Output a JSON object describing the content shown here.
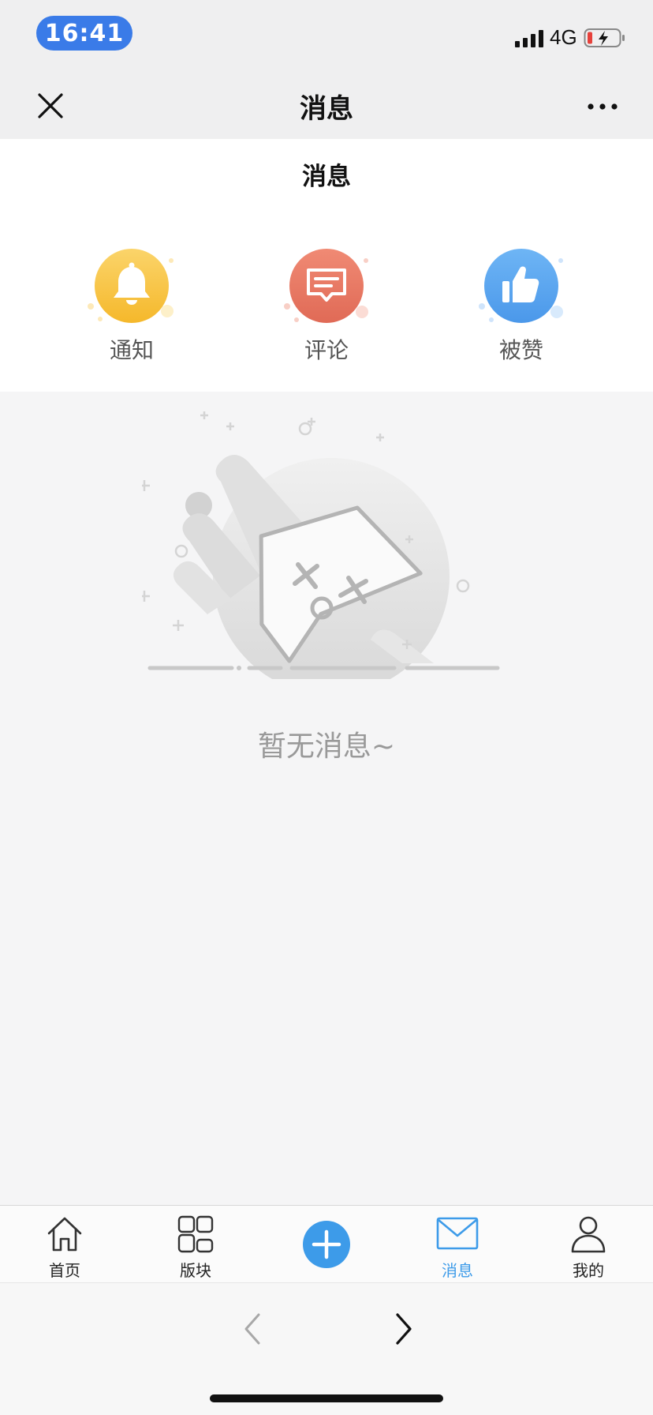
{
  "status_bar": {
    "time": "16:41",
    "network": "4G",
    "icons": [
      "signal-icon",
      "battery-charging-icon"
    ]
  },
  "nav_bar": {
    "title": "消息",
    "icons": [
      "close-icon",
      "more-icon"
    ]
  },
  "message_header": {
    "title": "消息",
    "categories": [
      {
        "label": "通知",
        "icon": "bell-icon",
        "color": "#f7c23e"
      },
      {
        "label": "评论",
        "icon": "comment-icon",
        "color": "#ea7a66"
      },
      {
        "label": "被赞",
        "icon": "thumbs-up-icon",
        "color": "#5aa6ef"
      }
    ]
  },
  "empty_state": {
    "text": "暂无消息~",
    "icon": "empty-star-illustration"
  },
  "tab_bar": {
    "active_color": "#3d9be9",
    "tabs": [
      {
        "label": "首页",
        "icon": "home-icon"
      },
      {
        "label": "版块",
        "icon": "grid-icon"
      },
      {
        "label": "",
        "icon": "plus-circle-icon"
      },
      {
        "label": "消息",
        "icon": "mail-icon",
        "active": true
      },
      {
        "label": "我的",
        "icon": "user-icon"
      }
    ]
  },
  "browser_nav": {
    "icons": [
      "back-arrow-icon",
      "forward-arrow-icon"
    ]
  }
}
